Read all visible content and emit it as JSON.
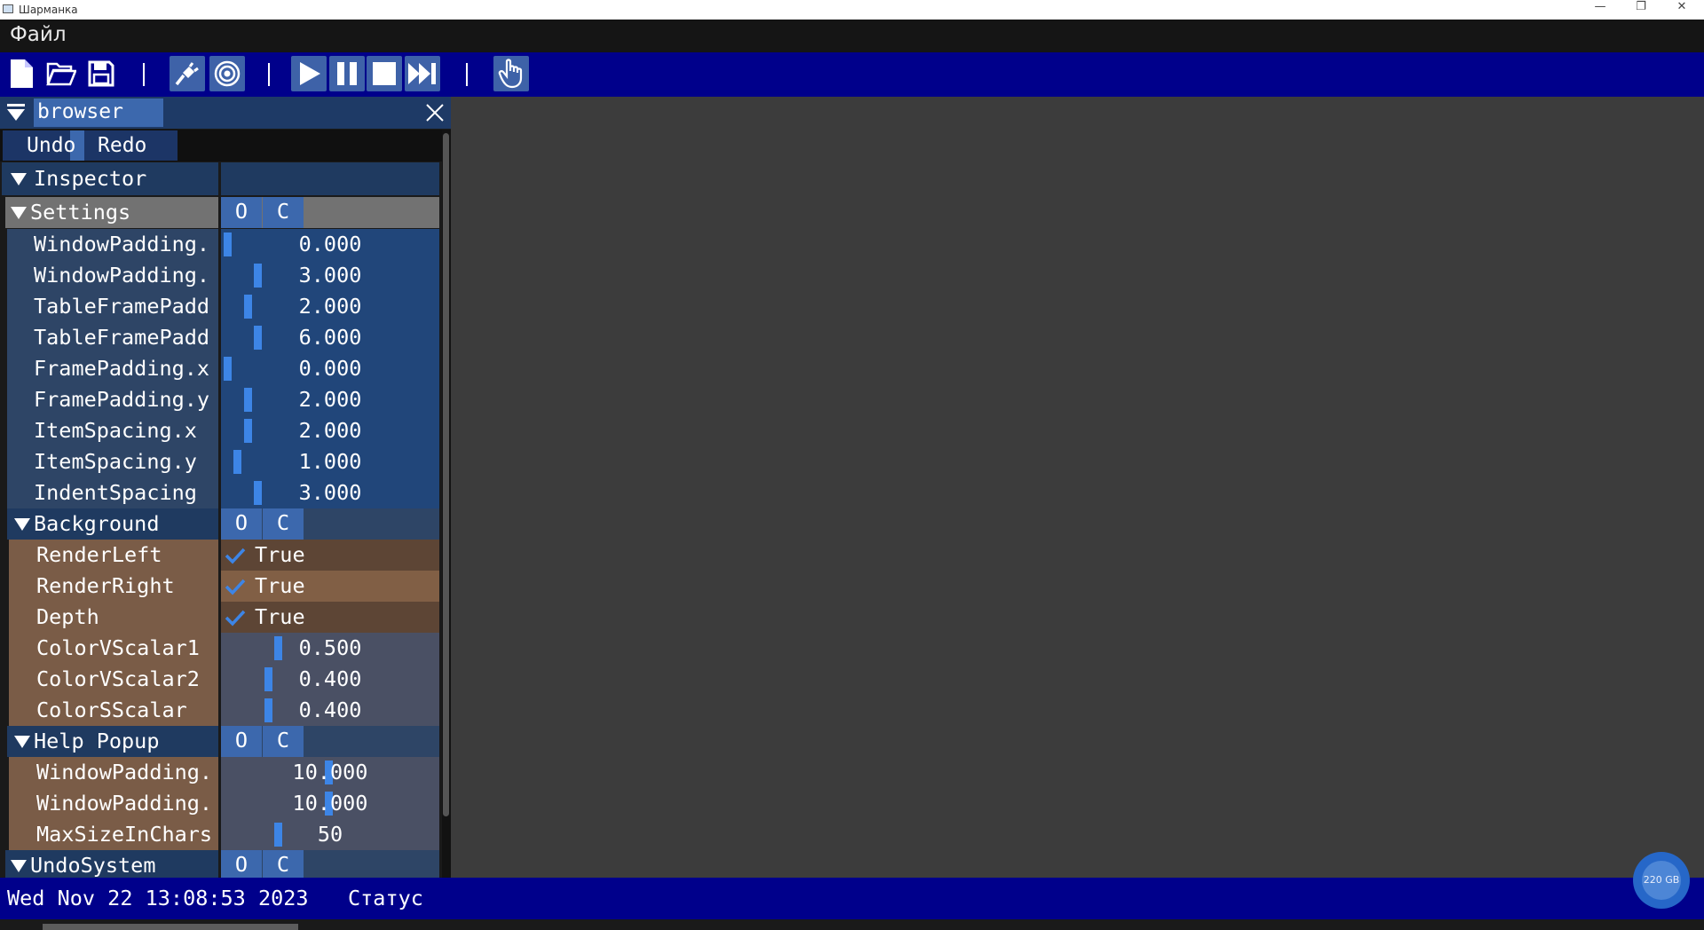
{
  "window": {
    "title": "Шарманка",
    "minimize_icon": "minimize-icon",
    "restore_icon": "restore-icon",
    "close_icon": "close-icon"
  },
  "menubar": {
    "file": "Файл"
  },
  "toolbar": {
    "buttons": [
      "new-file-icon",
      "open-folder-icon",
      "save-icon",
      "plug-icon",
      "target-icon",
      "play-icon",
      "pause-icon",
      "stop-icon",
      "skip-forward-icon",
      "hand-pointer-icon"
    ],
    "accent": "#00008b"
  },
  "panel": {
    "tab_title": "browser",
    "undo": "Undo",
    "redo": "Redo",
    "inspector": "Inspector",
    "open_label": "O",
    "close_label": "C",
    "settings": {
      "title": "Settings",
      "rows": [
        {
          "name": "WindowPadding.",
          "value": "0.000"
        },
        {
          "name": "WindowPadding.",
          "value": "3.000"
        },
        {
          "name": "TableFramePadd",
          "value": "2.000"
        },
        {
          "name": "TableFramePadd",
          "value": "6.000"
        },
        {
          "name": "FramePadding.x",
          "value": "0.000"
        },
        {
          "name": "FramePadding.y",
          "value": "2.000"
        },
        {
          "name": "ItemSpacing.x",
          "value": "2.000"
        },
        {
          "name": "ItemSpacing.y",
          "value": "1.000"
        },
        {
          "name": "IndentSpacing",
          "value": "3.000"
        }
      ]
    },
    "background": {
      "title": "Background",
      "bools": [
        {
          "name": "RenderLeft",
          "value": "True"
        },
        {
          "name": "RenderRight",
          "value": "True"
        },
        {
          "name": "Depth",
          "value": "True"
        }
      ],
      "scalars": [
        {
          "name": "ColorVScalar1",
          "value": "0.500"
        },
        {
          "name": "ColorVScalar2",
          "value": "0.400"
        },
        {
          "name": "ColorSScalar",
          "value": "0.400"
        }
      ]
    },
    "help_popup": {
      "title": "Help Popup",
      "rows": [
        {
          "name": "WindowPadding.",
          "value": "10.000"
        },
        {
          "name": "WindowPadding.",
          "value": "10.000"
        },
        {
          "name": "MaxSizeInChars",
          "value": "50"
        }
      ]
    },
    "undo_system": {
      "title": "UndoSystem"
    }
  },
  "statusbar": {
    "date": "Wed Nov 22 13:08:53 2023",
    "status": "Статус"
  },
  "disk_badge": "220 GB"
}
